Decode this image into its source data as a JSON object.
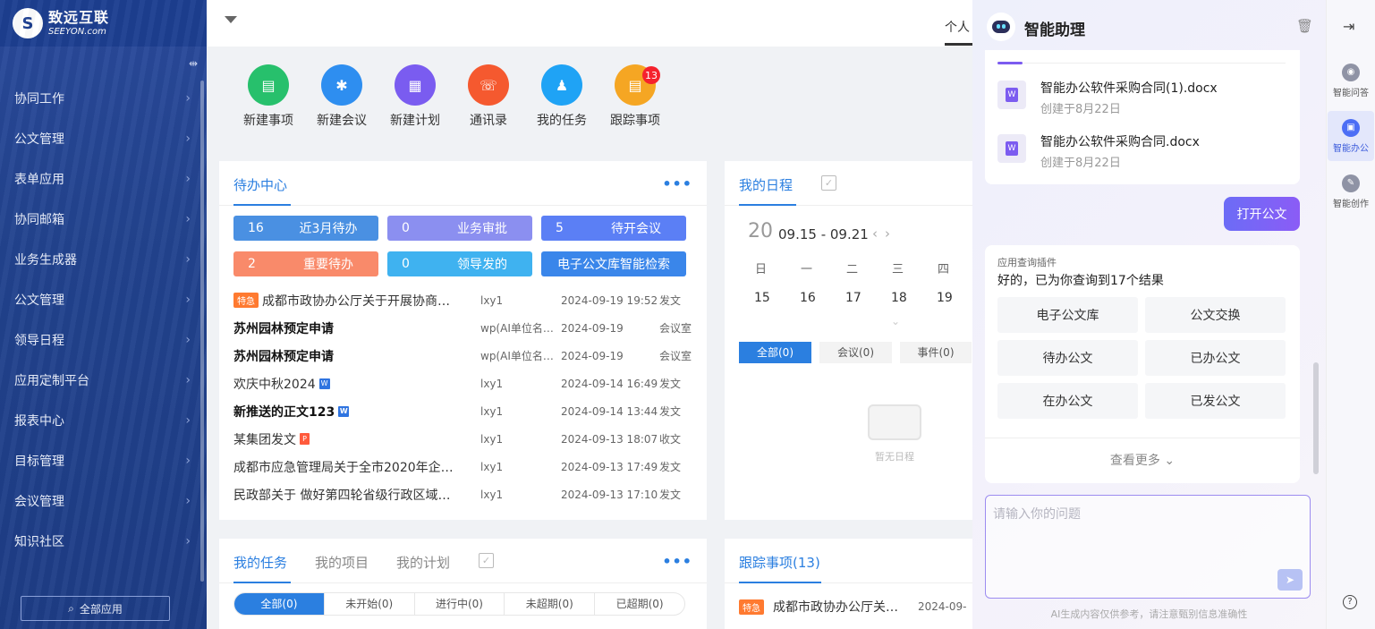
{
  "sidebar": {
    "logo_cn": "致远互联",
    "logo_en": "SEEYON.com",
    "collapse_icon": "⇹",
    "items": [
      {
        "label": "协同工作"
      },
      {
        "label": "公文管理"
      },
      {
        "label": "表单应用"
      },
      {
        "label": "协同邮箱"
      },
      {
        "label": "业务生成器"
      },
      {
        "label": "公文管理"
      },
      {
        "label": "领导日程"
      },
      {
        "label": "应用定制平台"
      },
      {
        "label": "报表中心"
      },
      {
        "label": "目标管理"
      },
      {
        "label": "会议管理"
      },
      {
        "label": "知识社区"
      }
    ],
    "all_apps_label": "全部应用"
  },
  "topbar": {
    "tab_label": "个人"
  },
  "quick_actions": [
    {
      "label": "新建事项",
      "color": "#27c06c",
      "icon": "▤"
    },
    {
      "label": "新建会议",
      "color": "#2e8ef0",
      "icon": "✱"
    },
    {
      "label": "新建计划",
      "color": "#7a5cf0",
      "icon": "▦"
    },
    {
      "label": "通讯录",
      "color": "#f5592f",
      "icon": "☏"
    },
    {
      "label": "我的任务",
      "color": "#1fa3f5",
      "icon": "♟"
    },
    {
      "label": "跟踪事项",
      "color": "#f5a623",
      "icon": "▤",
      "badge": "13"
    }
  ],
  "todo": {
    "title": "待办中心",
    "more": "•••",
    "pills": [
      {
        "n": "16",
        "label": "近3月待办",
        "color": "#4a90e2"
      },
      {
        "n": "0",
        "label": "业务审批",
        "color": "#8b8ff0"
      },
      {
        "n": "5",
        "label": "待开会议",
        "color": "#5b7ff5"
      },
      {
        "n": "2",
        "label": "重要待办",
        "color": "#f98a6a"
      },
      {
        "n": "0",
        "label": "领导发的",
        "color": "#3fb2f0"
      },
      {
        "n": "",
        "label": "电子公文库智能检索",
        "color": "#3a86ea"
      }
    ],
    "rows": [
      {
        "tag": "特急",
        "title": "成都市政协办公厅关于开展协商…",
        "author": "lxy1",
        "date": "2024-09-19 19:52",
        "type": "发文"
      },
      {
        "title": "苏州园林预定申请",
        "bold": true,
        "author": "wp(AI单位名…",
        "date": "2024-09-19",
        "type": "会议室"
      },
      {
        "title": "苏州园林预定申请",
        "bold": true,
        "author": "wp(AI单位名…",
        "date": "2024-09-19",
        "type": "会议室"
      },
      {
        "title": "欢庆中秋2024",
        "icon": "W",
        "author": "lxy1",
        "date": "2024-09-14 16:49",
        "type": "发文"
      },
      {
        "title": "新推送的正文123",
        "bold": true,
        "icon": "W",
        "author": "lxy1",
        "date": "2024-09-14 13:44",
        "type": "发文"
      },
      {
        "title": "某集团发文",
        "icon": "P",
        "author": "lxy1",
        "date": "2024-09-13 18:07",
        "type": "收文"
      },
      {
        "title": "成都市应急管理局关于全市2020年企…",
        "author": "lxy1",
        "date": "2024-09-13 17:49",
        "type": "发文"
      },
      {
        "title": "民政部关于 做好第四轮省级行政区域…",
        "author": "lxy1",
        "date": "2024-09-13 17:10",
        "type": "发文"
      }
    ]
  },
  "schedule": {
    "title": "我的日程",
    "day": "20",
    "range": "09.15 - 09.21",
    "weekdays": [
      "日",
      "一",
      "二",
      "三",
      "四"
    ],
    "dates": [
      "15",
      "16",
      "17",
      "18",
      "19"
    ],
    "filters": [
      "全部(0)",
      "会议(0)",
      "事件(0)"
    ],
    "empty": "暂无日程"
  },
  "tasks": {
    "tabs": [
      "我的任务",
      "我的项目",
      "我的计划"
    ],
    "more": "•••",
    "filters": [
      "全部(0)",
      "未开始(0)",
      "进行中(0)",
      "未超期(0)",
      "已超期(0)"
    ]
  },
  "tracking": {
    "title": "跟踪事项(13)",
    "row": {
      "tag": "特急",
      "title": "成都市政协办公厅关…",
      "date": "2024-09-"
    }
  },
  "assistant": {
    "title": "智能助理",
    "docs": [
      {
        "name": "智能办公软件采购合同(1).docx",
        "date": "创建于8月22日"
      },
      {
        "name": "智能办公软件采购合同.docx",
        "date": "创建于8月22日"
      }
    ],
    "user_msg": "打开公文",
    "plugin_label": "应用查询插件",
    "result_text": "好的，已为你查询到17个结果",
    "options": [
      "电子公文库",
      "公文交换",
      "待办公文",
      "已办公文",
      "在办公文",
      "已发公文"
    ],
    "see_more": "查看更多",
    "input_placeholder": "请输入你的问题",
    "disclaimer": "AI生成内容仅供参考，请注意甄别信息准确性"
  },
  "rail": {
    "items": [
      {
        "label": "智能问答"
      },
      {
        "label": "智能办公"
      },
      {
        "label": "智能创作"
      }
    ],
    "help": "?"
  }
}
